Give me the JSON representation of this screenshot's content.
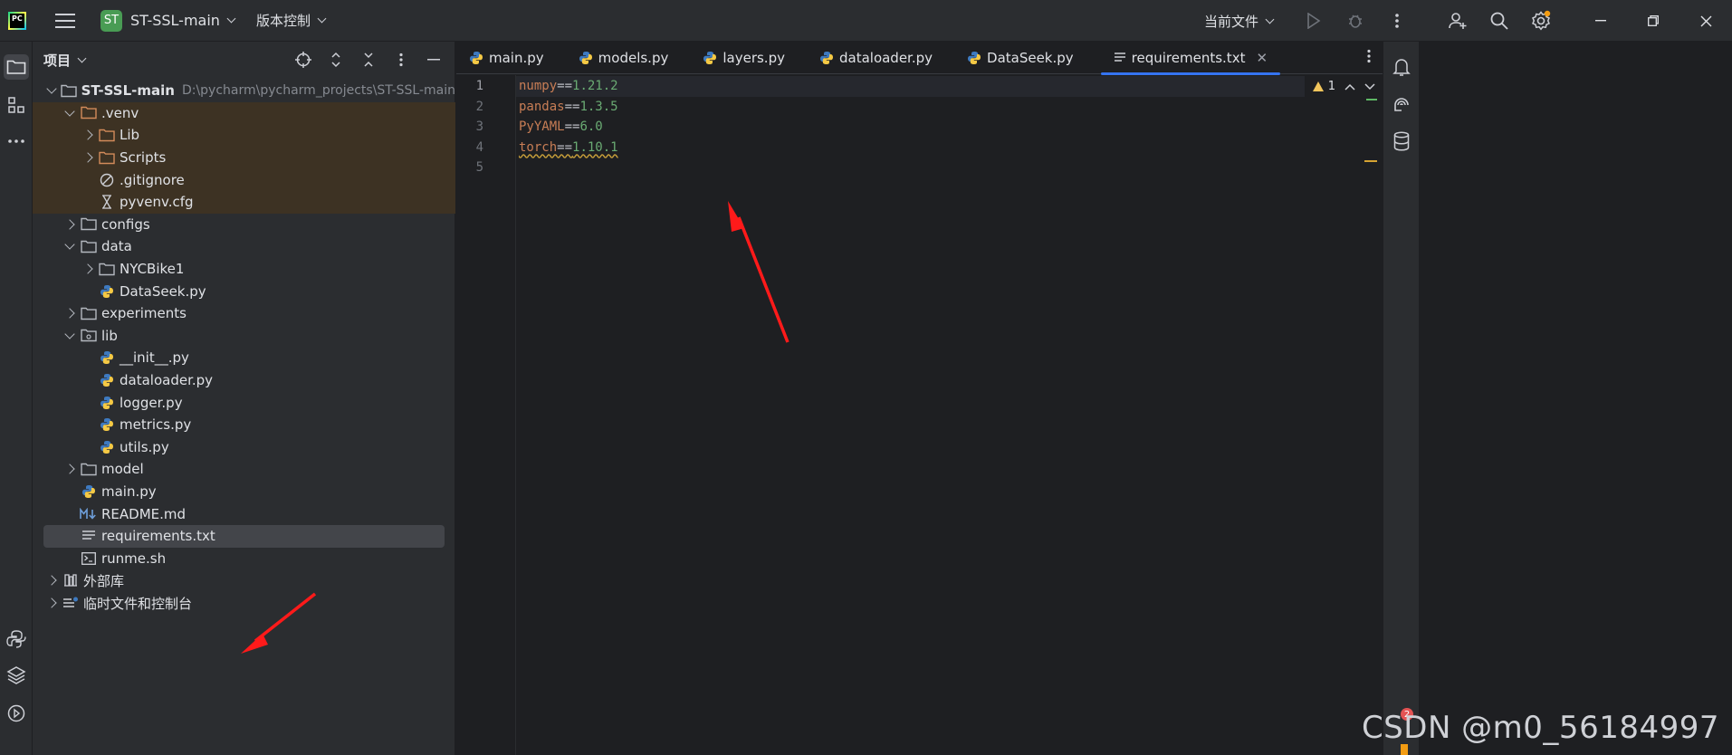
{
  "titlebar": {
    "project_badge": "ST",
    "project_name": "ST-SSL-main",
    "vcs_label": "版本控制",
    "run_target": "当前文件"
  },
  "project_panel": {
    "title": "项目",
    "root": {
      "name": "ST-SSL-main",
      "path": "D:\\pycharm\\pycharm_projects\\ST-SSL-main"
    },
    "rows": [
      {
        "label": ".venv"
      },
      {
        "label": "Lib"
      },
      {
        "label": "Scripts"
      },
      {
        "label": ".gitignore"
      },
      {
        "label": "pyvenv.cfg"
      },
      {
        "label": "configs"
      },
      {
        "label": "data"
      },
      {
        "label": "NYCBike1"
      },
      {
        "label": "DataSeek.py"
      },
      {
        "label": "experiments"
      },
      {
        "label": "lib"
      },
      {
        "label": "__init__.py"
      },
      {
        "label": "dataloader.py"
      },
      {
        "label": "logger.py"
      },
      {
        "label": "metrics.py"
      },
      {
        "label": "utils.py"
      },
      {
        "label": "model"
      },
      {
        "label": "main.py"
      },
      {
        "label": "README.md"
      },
      {
        "label": "requirements.txt"
      },
      {
        "label": "runme.sh"
      },
      {
        "label": "外部库"
      },
      {
        "label": "临时文件和控制台"
      }
    ]
  },
  "tabs": [
    {
      "label": "main.py"
    },
    {
      "label": "models.py"
    },
    {
      "label": "layers.py"
    },
    {
      "label": "dataloader.py"
    },
    {
      "label": "DataSeek.py"
    },
    {
      "label": "requirements.txt",
      "active": true
    }
  ],
  "editor": {
    "line_numbers": [
      "1",
      "2",
      "3",
      "4",
      "5"
    ],
    "lines": [
      {
        "pkg": "numpy",
        "op": "==",
        "ver": "1.21.2"
      },
      {
        "pkg": "pandas",
        "op": "==",
        "ver": "1.3.5"
      },
      {
        "pkg": "PyYAML",
        "op": "==",
        "ver": "6.0"
      },
      {
        "pkg": "torch",
        "op": "==",
        "ver": "1.10.1"
      }
    ],
    "warning_count": "1"
  },
  "watermark": "CSDN @m0_56184997",
  "notification_badge": "2",
  "colors": {
    "accent": "#3574f0",
    "excluded_bg": "#3d3223",
    "annotation_red": "#ff1a1a",
    "python_blue": "#3e7ac0",
    "python_yellow": "#f5c945"
  }
}
